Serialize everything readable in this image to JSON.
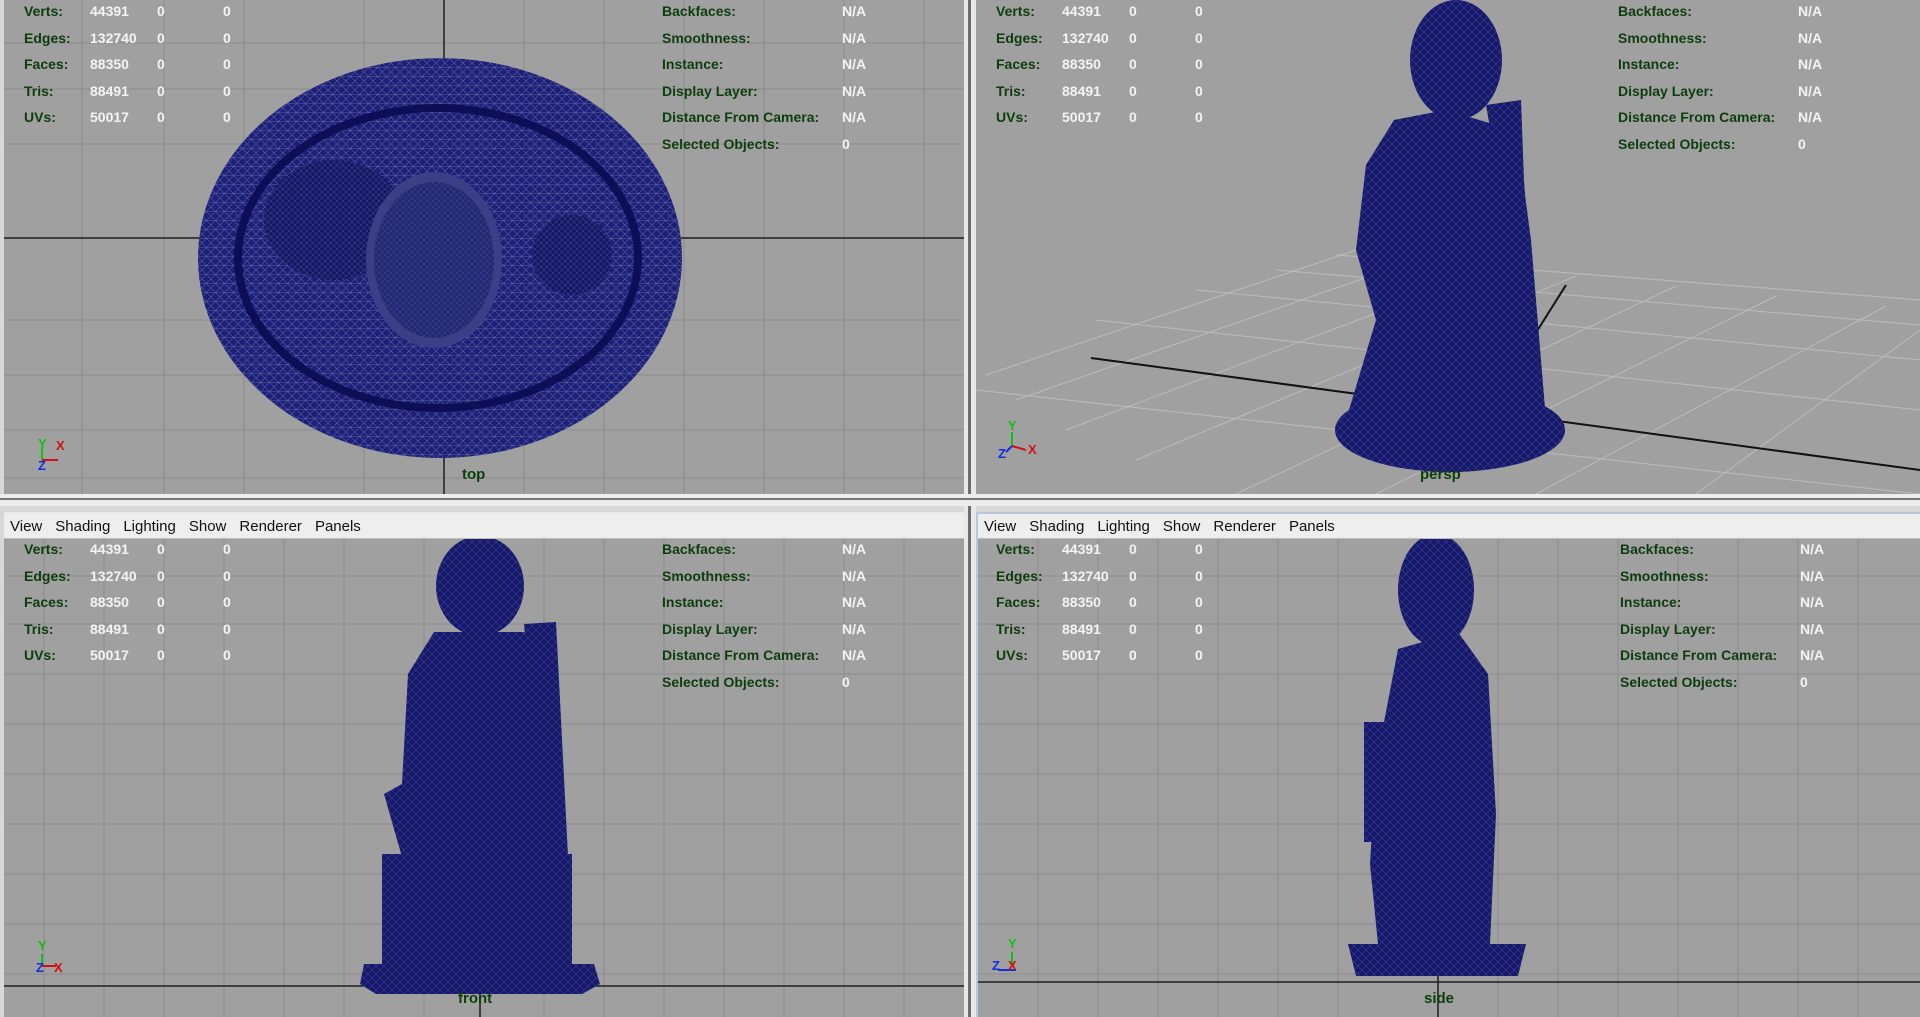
{
  "menu": [
    "View",
    "Shading",
    "Lighting",
    "Show",
    "Renderer",
    "Panels"
  ],
  "stats": [
    {
      "label": "Verts:",
      "v": [
        "44391",
        "0",
        "0"
      ]
    },
    {
      "label": "Edges:",
      "v": [
        "132740",
        "0",
        "0"
      ]
    },
    {
      "label": "Faces:",
      "v": [
        "88350",
        "0",
        "0"
      ]
    },
    {
      "label": "Tris:",
      "v": [
        "88491",
        "0",
        "0"
      ]
    },
    {
      "label": "UVs:",
      "v": [
        "50017",
        "0",
        "0"
      ]
    }
  ],
  "info": [
    {
      "label": "Backfaces:",
      "v": "N/A"
    },
    {
      "label": "Smoothness:",
      "v": "N/A"
    },
    {
      "label": "Instance:",
      "v": "N/A"
    },
    {
      "label": "Display Layer:",
      "v": "N/A"
    },
    {
      "label": "Distance From Camera:",
      "v": "N/A"
    },
    {
      "label": "Selected Objects:",
      "v": "0"
    }
  ],
  "viewports": {
    "top": {
      "camera": "top",
      "axes": [
        "Y",
        "X",
        "Z"
      ]
    },
    "persp": {
      "camera": "persp",
      "axes": [
        "Y",
        "Z",
        "X"
      ]
    },
    "front": {
      "camera": "front",
      "axes": [
        "Y",
        "Z",
        "X"
      ]
    },
    "side": {
      "camera": "side",
      "axes": [
        "Y",
        "Z",
        "X"
      ]
    }
  },
  "colors": {
    "viewport_bg": "#a0a0a0",
    "mesh": "#14186a",
    "hud_label": "#0d3d0d",
    "grid": "#8a8a8a",
    "axis_line": "#222222",
    "x_axis": "#d01010",
    "y_axis": "#10c010",
    "z_axis": "#1030e0"
  }
}
